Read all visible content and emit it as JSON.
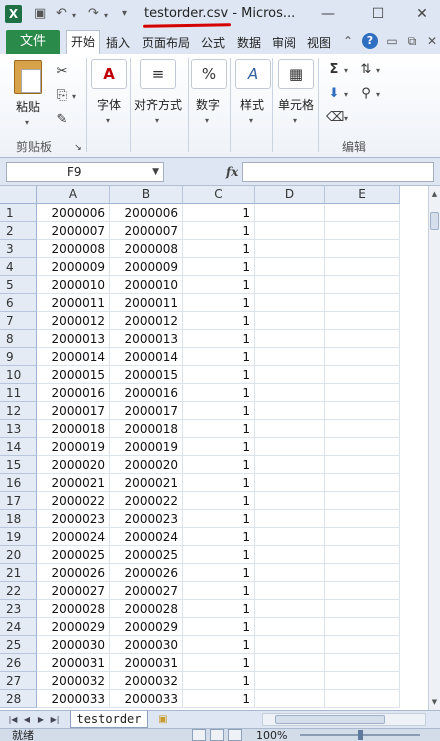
{
  "window": {
    "title": "testorder.csv  -  Micros...",
    "app_logo": "X",
    "accent": "#2a8a4a"
  },
  "ribbon_tabs": {
    "file": "文件",
    "tabs": [
      "开始",
      "插入",
      "页面布局",
      "公式",
      "数据",
      "审阅",
      "视图"
    ]
  },
  "ribbon": {
    "clipboard": {
      "paste": "粘贴",
      "group": "剪贴板"
    },
    "font": {
      "label": "字体",
      "icon_text": "A"
    },
    "alignment": {
      "label": "对齐方式"
    },
    "number": {
      "label": "数字",
      "icon_text": "%"
    },
    "styles": {
      "label": "样式",
      "icon_text": "A"
    },
    "cells": {
      "label": "单元格"
    },
    "editing": {
      "group": "编辑",
      "sum_icon": "Σ"
    }
  },
  "formula_bar": {
    "name_box": "F9",
    "fx": "fx",
    "content": ""
  },
  "sheet": {
    "columns": [
      "A",
      "B",
      "C",
      "D",
      "E"
    ],
    "rows": [
      {
        "n": "1",
        "a": "2000006",
        "b": "2000006",
        "c": "1"
      },
      {
        "n": "2",
        "a": "2000007",
        "b": "2000007",
        "c": "1"
      },
      {
        "n": "3",
        "a": "2000008",
        "b": "2000008",
        "c": "1"
      },
      {
        "n": "4",
        "a": "2000009",
        "b": "2000009",
        "c": "1"
      },
      {
        "n": "5",
        "a": "2000010",
        "b": "2000010",
        "c": "1"
      },
      {
        "n": "6",
        "a": "2000011",
        "b": "2000011",
        "c": "1"
      },
      {
        "n": "7",
        "a": "2000012",
        "b": "2000012",
        "c": "1"
      },
      {
        "n": "8",
        "a": "2000013",
        "b": "2000013",
        "c": "1"
      },
      {
        "n": "9",
        "a": "2000014",
        "b": "2000014",
        "c": "1"
      },
      {
        "n": "10",
        "a": "2000015",
        "b": "2000015",
        "c": "1"
      },
      {
        "n": "11",
        "a": "2000016",
        "b": "2000016",
        "c": "1"
      },
      {
        "n": "12",
        "a": "2000017",
        "b": "2000017",
        "c": "1"
      },
      {
        "n": "13",
        "a": "2000018",
        "b": "2000018",
        "c": "1"
      },
      {
        "n": "14",
        "a": "2000019",
        "b": "2000019",
        "c": "1"
      },
      {
        "n": "15",
        "a": "2000020",
        "b": "2000020",
        "c": "1"
      },
      {
        "n": "16",
        "a": "2000021",
        "b": "2000021",
        "c": "1"
      },
      {
        "n": "17",
        "a": "2000022",
        "b": "2000022",
        "c": "1"
      },
      {
        "n": "18",
        "a": "2000023",
        "b": "2000023",
        "c": "1"
      },
      {
        "n": "19",
        "a": "2000024",
        "b": "2000024",
        "c": "1"
      },
      {
        "n": "20",
        "a": "2000025",
        "b": "2000025",
        "c": "1"
      },
      {
        "n": "21",
        "a": "2000026",
        "b": "2000026",
        "c": "1"
      },
      {
        "n": "22",
        "a": "2000027",
        "b": "2000027",
        "c": "1"
      },
      {
        "n": "23",
        "a": "2000028",
        "b": "2000028",
        "c": "1"
      },
      {
        "n": "24",
        "a": "2000029",
        "b": "2000029",
        "c": "1"
      },
      {
        "n": "25",
        "a": "2000030",
        "b": "2000030",
        "c": "1"
      },
      {
        "n": "26",
        "a": "2000031",
        "b": "2000031",
        "c": "1"
      },
      {
        "n": "27",
        "a": "2000032",
        "b": "2000032",
        "c": "1"
      },
      {
        "n": "28",
        "a": "2000033",
        "b": "2000033",
        "c": "1"
      }
    ],
    "tab_name": "testorder"
  },
  "status": {
    "ready": "就绪",
    "zoom": "100%"
  }
}
